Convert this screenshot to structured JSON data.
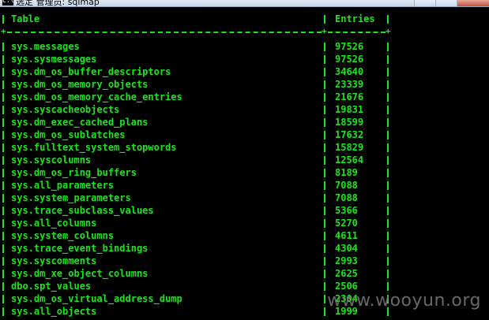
{
  "window": {
    "icon_label": "C:\\",
    "title": "选定 管理员: sqlmap"
  },
  "table": {
    "headers": {
      "name": "Table",
      "entries": "Entries"
    },
    "rows": [
      {
        "name": "sys.messages",
        "entries": "97526"
      },
      {
        "name": "sys.sysmessages",
        "entries": "97526"
      },
      {
        "name": "sys.dm_os_buffer_descriptors",
        "entries": "34640"
      },
      {
        "name": "sys.dm_os_memory_objects",
        "entries": "23339"
      },
      {
        "name": "sys.dm_os_memory_cache_entries",
        "entries": "21676"
      },
      {
        "name": "sys.syscacheobjects",
        "entries": "19831"
      },
      {
        "name": "sys.dm_exec_cached_plans",
        "entries": "18599"
      },
      {
        "name": "sys.dm_os_sublatches",
        "entries": "17632"
      },
      {
        "name": "sys.fulltext_system_stopwords",
        "entries": "15829"
      },
      {
        "name": "sys.syscolumns",
        "entries": "12564"
      },
      {
        "name": "sys.dm_os_ring_buffers",
        "entries": "8189"
      },
      {
        "name": "sys.all_parameters",
        "entries": "7088"
      },
      {
        "name": "sys.system_parameters",
        "entries": "7088"
      },
      {
        "name": "sys.trace_subclass_values",
        "entries": "5366"
      },
      {
        "name": "sys.all_columns",
        "entries": "5270"
      },
      {
        "name": "sys.system_columns",
        "entries": "4611"
      },
      {
        "name": "sys.trace_event_bindings",
        "entries": "4304"
      },
      {
        "name": "sys.syscomments",
        "entries": "2993"
      },
      {
        "name": "sys.dm_xe_object_columns",
        "entries": "2625"
      },
      {
        "name": "dbo.spt_values",
        "entries": "2506"
      },
      {
        "name": "sys.dm_os_virtual_address_dump",
        "entries": "2304"
      },
      {
        "name": "sys.all_objects",
        "entries": "1999"
      }
    ]
  },
  "watermark": "www.wooyun.org",
  "colors": {
    "terminal_text": "#19e619",
    "terminal_bg": "#000000"
  }
}
